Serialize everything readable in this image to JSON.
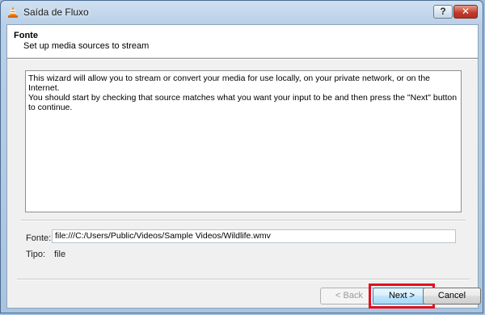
{
  "window": {
    "title": "Saída de Fluxo",
    "help_label": "?",
    "close_label": "✕"
  },
  "header": {
    "title": "Fonte",
    "subtitle": "Set up media sources to stream"
  },
  "description": {
    "line1": "This wizard will allow you to stream or convert your media for use locally, on your private network, or on the Internet.",
    "line2": "You should start by checking that source matches what you want your input to be and then press the \"Next\" button to continue."
  },
  "source": {
    "fonte_label": "Fonte:",
    "fonte_value": "file:///C:/Users/Public/Videos/Sample Videos/Wildlife.wmv",
    "tipo_label": "Tipo:",
    "tipo_value": "file"
  },
  "buttons": {
    "back": "< Back",
    "next": "Next >",
    "cancel": "Cancel"
  },
  "colors": {
    "highlight": "#e3101f",
    "close_button": "#c0392b"
  },
  "icons": {
    "app": "vlc-cone-icon"
  }
}
